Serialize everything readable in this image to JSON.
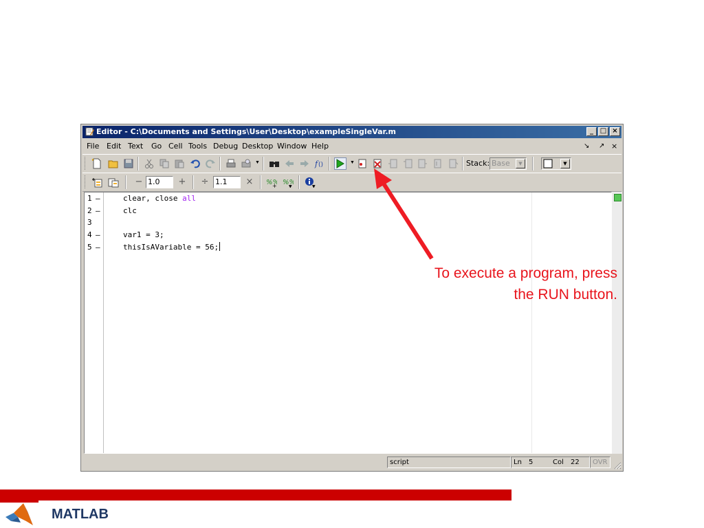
{
  "window": {
    "title": "Editor - C:\\Documents and Settings\\User\\Desktop\\exampleSingleVar.m",
    "controls": [
      "_",
      "□",
      "×"
    ]
  },
  "menu": {
    "items": [
      "File",
      "Edit",
      "Text",
      "Go",
      "Cell",
      "Tools",
      "Debug",
      "Desktop",
      "Window",
      "Help"
    ],
    "right_controls": [
      "↘",
      "↗",
      "×"
    ]
  },
  "toolbar": {
    "stack_label": "Stack:",
    "stack_value": "Base",
    "icons": [
      "new-file-icon",
      "open-folder-icon",
      "save-icon",
      "cut-icon",
      "copy-icon",
      "paste-icon",
      "undo-icon",
      "redo-icon",
      "print-icon",
      "print-preview-icon",
      "find-icon",
      "back-icon",
      "forward-icon",
      "function-icon",
      "run-icon",
      "set-breakpoint-icon",
      "clear-breakpoint-icon",
      "step-icon",
      "step-in-icon",
      "step-out-icon",
      "continue-icon",
      "exit-debug-icon",
      "dock-icon"
    ]
  },
  "cell_toolbar": {
    "minus": "−",
    "value1": "1.0",
    "plus": "+",
    "divide": "÷",
    "value2": "1.1",
    "times": "×"
  },
  "editor": {
    "lines": [
      {
        "num": "1",
        "bp": "–",
        "code": "clear, close ",
        "kw": "all"
      },
      {
        "num": "2",
        "bp": "–",
        "code": "clc",
        "kw": ""
      },
      {
        "num": "3",
        "bp": "",
        "code": "",
        "kw": ""
      },
      {
        "num": "4",
        "bp": "–",
        "code": "var1 = 3;",
        "kw": ""
      },
      {
        "num": "5",
        "bp": "–",
        "code": "thisIsAVariable = 56;",
        "kw": ""
      }
    ]
  },
  "statusbar": {
    "mode": "script",
    "ln_label": "Ln",
    "ln_value": "5",
    "col_label": "Col",
    "col_value": "22",
    "ovr": "OVR"
  },
  "annotation": {
    "line1": "To execute a program, press",
    "line2": "the RUN button."
  },
  "footer": {
    "label": "MATLAB"
  },
  "colors": {
    "accent_red": "#cc0000",
    "annotation_red": "#e8141c",
    "keyword_purple": "#a020f0",
    "footer_text": "#1f3864"
  }
}
